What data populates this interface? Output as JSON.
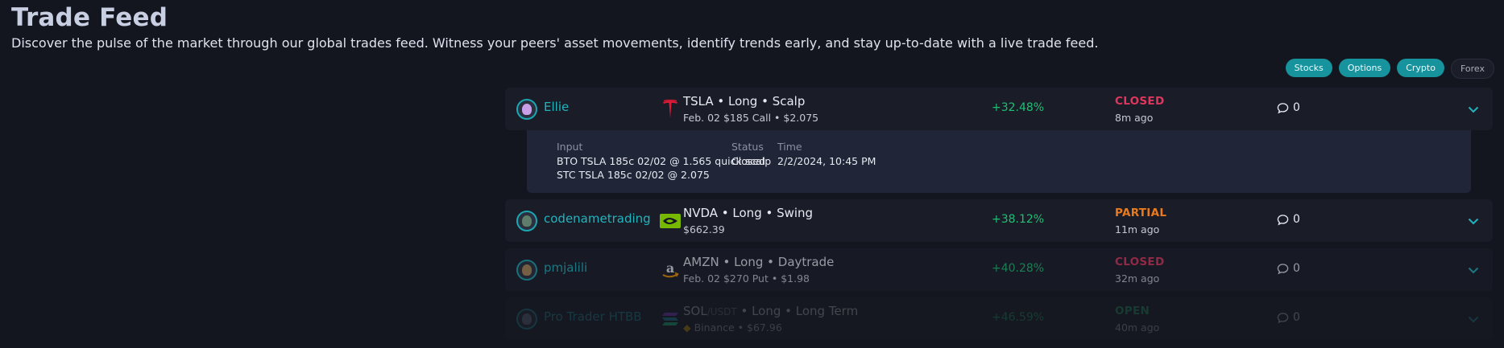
{
  "page": {
    "title": "Trade Feed",
    "subtitle": "Discover the pulse of the market through our global trades feed. Witness your peers' asset movements, identify trends early, and stay up-to-date with a live trade feed."
  },
  "filters": [
    {
      "label": "Stocks",
      "active": true
    },
    {
      "label": "Options",
      "active": true
    },
    {
      "label": "Crypto",
      "active": true
    },
    {
      "label": "Forex",
      "active": false
    }
  ],
  "trades": [
    {
      "user": "Ellie",
      "logo": "tesla-logo",
      "headline": "TSLA • Long • Scalp",
      "detail": "Feb. 02 $185 Call • $2.075",
      "pct": "+32.48%",
      "status": "CLOSED",
      "ago": "8m ago",
      "comments": "0",
      "expanded": {
        "input_label": "Input",
        "input_lines": [
          "BTO TSLA 185c 02/02 @ 1.565 quick scalp",
          "STC TSLA 185c 02/02 @ 2.075"
        ],
        "status_label": "Status",
        "status_value": "Closed",
        "time_label": "Time",
        "time_value": "2/2/2024, 10:45 PM"
      }
    },
    {
      "user": "codenametrading",
      "logo": "nvidia-logo",
      "headline": "NVDA • Long • Swing",
      "detail": "$662.39",
      "pct": "+38.12%",
      "status": "PARTIAL",
      "ago": "11m ago",
      "comments": "0"
    },
    {
      "user": "pmjalili",
      "logo": "amazon-logo",
      "headline": "AMZN • Long • Daytrade",
      "detail": "Feb. 02 $270 Put • $1.98",
      "pct": "+40.28%",
      "status": "CLOSED",
      "ago": "32m ago",
      "comments": "0"
    },
    {
      "user": "Pro Trader HTBB",
      "logo": "solana-logo",
      "headline_sym": "SOL",
      "headline_quote": "/USDT",
      "headline_rest": " • Long • Long Term",
      "detail": "Binance • $67.96",
      "pct": "+46.59%",
      "status": "OPEN",
      "ago": "40m ago",
      "comments": "0"
    }
  ],
  "colors": {
    "accent": "#16939c",
    "positive": "#1fbf73",
    "closed": "#e0365e",
    "partial": "#ea7a1e"
  }
}
